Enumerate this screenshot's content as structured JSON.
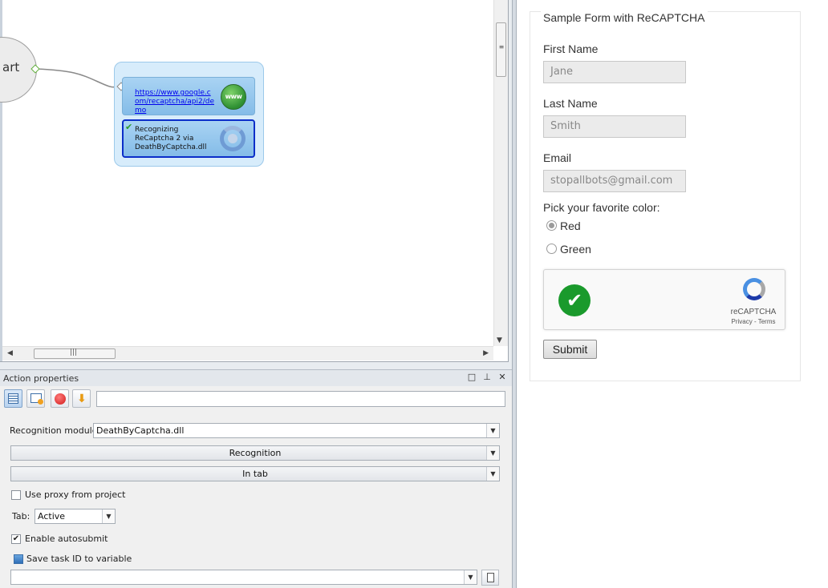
{
  "canvas": {
    "start_label": "art",
    "goto_action": {
      "url": "https://www.google.com/recaptcha/api2/demo",
      "icon": "globe-www-icon",
      "icon_text": "www"
    },
    "recog_action": {
      "label": "Recognizing ReCaptcha 2 via DeathByCaptcha.dll",
      "icon": "refresh-icon"
    }
  },
  "props": {
    "title": "Action properties",
    "header_buttons": {
      "restore": "□",
      "pin": "⊥",
      "close": "✕"
    },
    "toolbar_input": "",
    "recognition_module_label": "Recognition module:",
    "recognition_module_value": "DeathByCaptcha.dll",
    "recognition_section": "Recognition",
    "in_tab_section": "In tab",
    "use_proxy_label": "Use proxy from project",
    "use_proxy_checked": false,
    "tab_label": "Tab:",
    "tab_value": "Active",
    "enable_autosubmit_label": "Enable autosubmit",
    "enable_autosubmit_checked": true,
    "save_task_label": "Save task ID to variable",
    "save_task_value": ""
  },
  "form": {
    "legend": "Sample Form with ReCAPTCHA",
    "first_name_label": "First Name",
    "first_name_value": "Jane",
    "last_name_label": "Last Name",
    "last_name_value": "Smith",
    "email_label": "Email",
    "email_value": "stopallbots@gmail.com",
    "color_question": "Pick your favorite color:",
    "color_options": [
      "Red",
      "Green"
    ],
    "selected_color": "Red",
    "captcha_brand": "reCAPTCHA",
    "captcha_terms": "Privacy - Terms",
    "submit_label": "Submit"
  },
  "colors": {
    "selection_border": "#0b2ec9",
    "block_fill": "#a9d3f3",
    "captcha_green": "#1a9a2c"
  }
}
